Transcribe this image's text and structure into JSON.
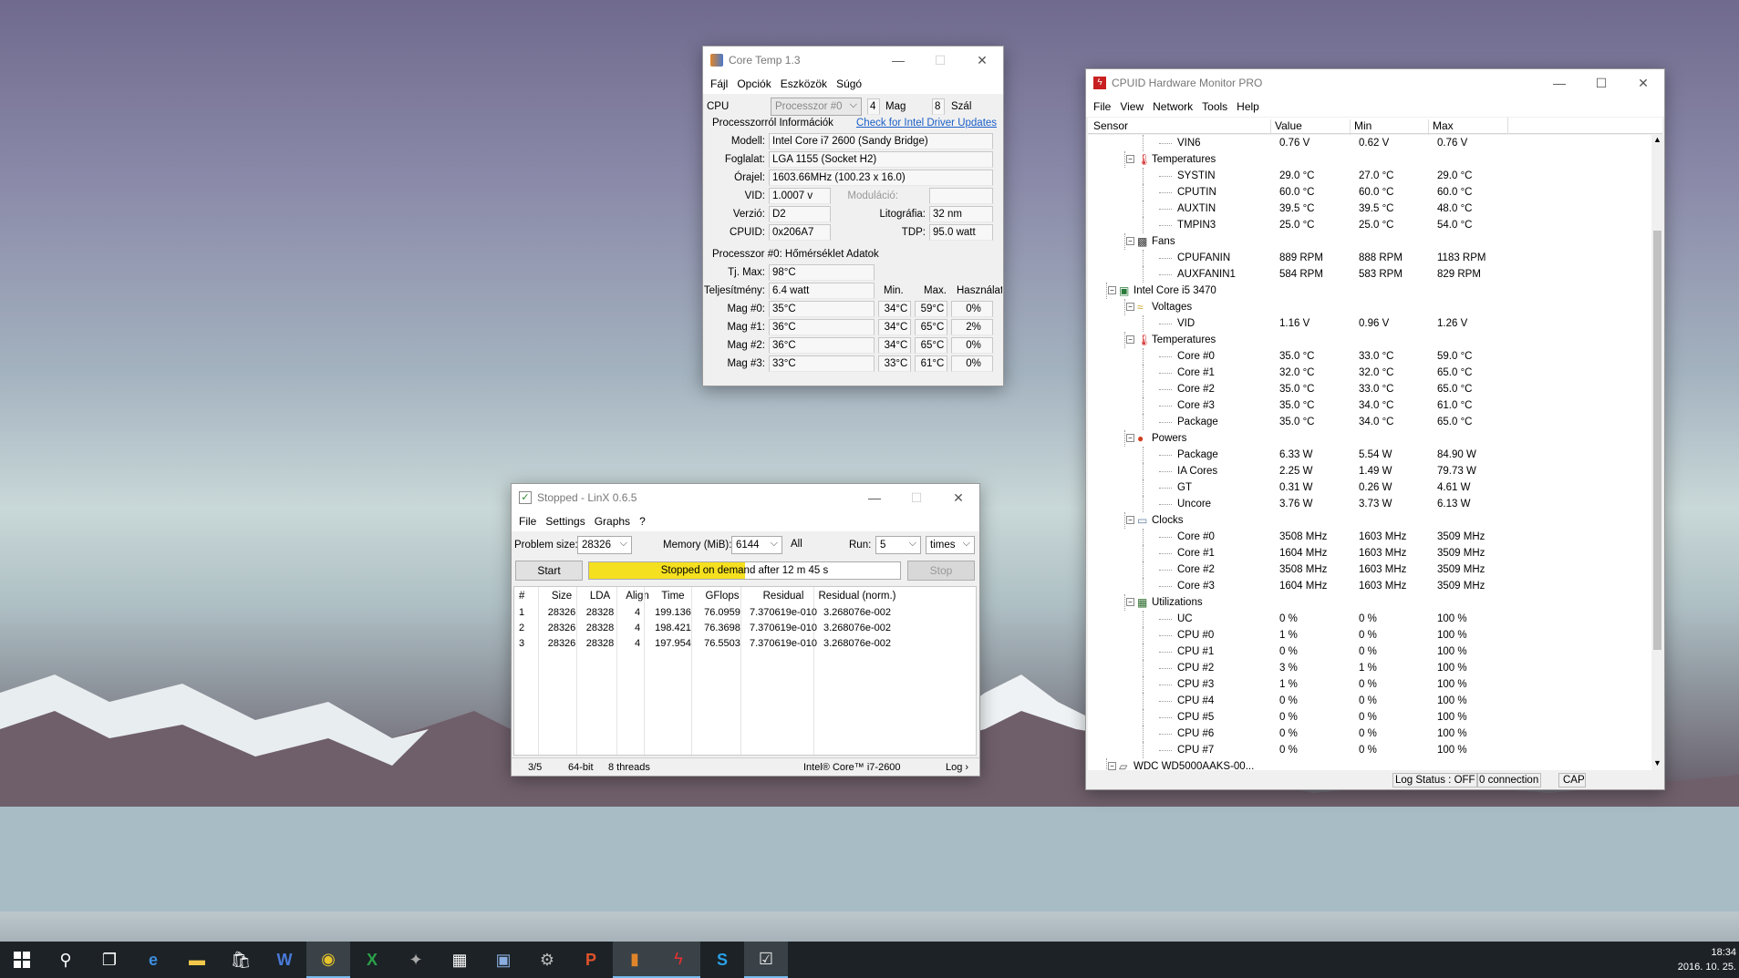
{
  "coretemp": {
    "title": "Core Temp 1.3",
    "menu": [
      "Fájl",
      "Opciók",
      "Eszközök",
      "Súgó"
    ],
    "cpu_label": "CPU",
    "processor_select": "Processzor #0",
    "cores": "4",
    "cores_label": "Mag",
    "threads": "8",
    "threads_label": "Szál",
    "info_header": "Processzorról Információk",
    "driver_link": "Check for Intel Driver Updates",
    "model_label": "Modell:",
    "model": "Intel Core i7 2600 (Sandy Bridge)",
    "socket_label": "Foglalat:",
    "socket": "LGA 1155 (Socket H2)",
    "clock_label": "Órajel:",
    "clock": "1603.66MHz (100.23 x 16.0)",
    "vid_label": "VID:",
    "vid": "1.0007 v",
    "mod_label": "Moduláció:",
    "mod": "",
    "rev_label": "Verzió:",
    "rev": "D2",
    "litho_label": "Litográfia:",
    "litho": "32 nm",
    "cpuid_label": "CPUID:",
    "cpuid": "0x206A7",
    "tdp_label": "TDP:",
    "tdp": "95.0 watt",
    "temp_header": "Processzor #0: Hőmérséklet Adatok",
    "tjmax_label": "Tj. Max:",
    "tjmax": "98°C",
    "power_label": "Teljesítmény:",
    "power": "6.4 watt",
    "min_h": "Min.",
    "max_h": "Max.",
    "load_h": "Használat",
    "cores_list": [
      {
        "label": "Mag #0:",
        "temp": "35°C",
        "min": "34°C",
        "max": "59°C",
        "load": "0%"
      },
      {
        "label": "Mag #1:",
        "temp": "36°C",
        "min": "34°C",
        "max": "65°C",
        "load": "2%"
      },
      {
        "label": "Mag #2:",
        "temp": "36°C",
        "min": "34°C",
        "max": "65°C",
        "load": "0%"
      },
      {
        "label": "Mag #3:",
        "temp": "33°C",
        "min": "33°C",
        "max": "61°C",
        "load": "0%"
      }
    ]
  },
  "linx": {
    "title": "Stopped - LinX 0.6.5",
    "menu": [
      "File",
      "Settings",
      "Graphs",
      "?"
    ],
    "problem_label": "Problem size:",
    "problem": "28326",
    "memory_label": "Memory (MiB):",
    "memory": "6144",
    "all": "All",
    "run_label": "Run:",
    "run": "5",
    "times": "times",
    "start": "Start",
    "status": "Stopped on demand after 12 m 45 s",
    "stop": "Stop",
    "headers": [
      "#",
      "Size",
      "LDA",
      "Align",
      "Time",
      "GFlops",
      "Residual",
      "Residual (norm.)"
    ],
    "rows": [
      [
        "1",
        "28326",
        "28328",
        "4",
        "199.136",
        "76.0959",
        "7.370619e-010",
        "3.268076e-002"
      ],
      [
        "2",
        "28326",
        "28328",
        "4",
        "198.421",
        "76.3698",
        "7.370619e-010",
        "3.268076e-002"
      ],
      [
        "3",
        "28326",
        "28328",
        "4",
        "197.954",
        "76.5503",
        "7.370619e-010",
        "3.268076e-002"
      ]
    ],
    "status_bar": [
      "3/5",
      "64-bit",
      "8 threads",
      "Intel® Core™ i7-2600",
      "Log ›"
    ]
  },
  "hwmon": {
    "title": "CPUID Hardware Monitor PRO",
    "menu": [
      "File",
      "View",
      "Network",
      "Tools",
      "Help"
    ],
    "headers": [
      "Sensor",
      "Value",
      "Min",
      "Max"
    ],
    "rows": [
      {
        "l": 3,
        "n": "VIN6",
        "v": "0.76 V",
        "mn": "0.62 V",
        "mx": "0.76 V"
      },
      {
        "l": 2,
        "n": "Temperatures",
        "v": "",
        "mn": "",
        "mx": "",
        "ic": "temp"
      },
      {
        "l": 3,
        "n": "SYSTIN",
        "v": "29.0 °C",
        "mn": "27.0 °C",
        "mx": "29.0 °C"
      },
      {
        "l": 3,
        "n": "CPUTIN",
        "v": "60.0 °C",
        "mn": "60.0 °C",
        "mx": "60.0 °C"
      },
      {
        "l": 3,
        "n": "AUXTIN",
        "v": "39.5 °C",
        "mn": "39.5 °C",
        "mx": "48.0 °C"
      },
      {
        "l": 3,
        "n": "TMPIN3",
        "v": "25.0 °C",
        "mn": "25.0 °C",
        "mx": "54.0 °C"
      },
      {
        "l": 2,
        "n": "Fans",
        "v": "",
        "mn": "",
        "mx": "",
        "ic": "fan"
      },
      {
        "l": 3,
        "n": "CPUFANIN",
        "v": "889 RPM",
        "mn": "888 RPM",
        "mx": "1183 RPM"
      },
      {
        "l": 3,
        "n": "AUXFANIN1",
        "v": "584 RPM",
        "mn": "583 RPM",
        "mx": "829 RPM"
      },
      {
        "l": 1,
        "n": "Intel Core i5 3470",
        "v": "",
        "mn": "",
        "mx": "",
        "ic": "chip"
      },
      {
        "l": 2,
        "n": "Voltages",
        "v": "",
        "mn": "",
        "mx": "",
        "ic": "volt"
      },
      {
        "l": 3,
        "n": "VID",
        "v": "1.16 V",
        "mn": "0.96 V",
        "mx": "1.26 V"
      },
      {
        "l": 2,
        "n": "Temperatures",
        "v": "",
        "mn": "",
        "mx": "",
        "ic": "temp"
      },
      {
        "l": 3,
        "n": "Core #0",
        "v": "35.0 °C",
        "mn": "33.0 °C",
        "mx": "59.0 °C"
      },
      {
        "l": 3,
        "n": "Core #1",
        "v": "32.0 °C",
        "mn": "32.0 °C",
        "mx": "65.0 °C"
      },
      {
        "l": 3,
        "n": "Core #2",
        "v": "35.0 °C",
        "mn": "33.0 °C",
        "mx": "65.0 °C"
      },
      {
        "l": 3,
        "n": "Core #3",
        "v": "35.0 °C",
        "mn": "34.0 °C",
        "mx": "61.0 °C"
      },
      {
        "l": 3,
        "n": "Package",
        "v": "35.0 °C",
        "mn": "34.0 °C",
        "mx": "65.0 °C"
      },
      {
        "l": 2,
        "n": "Powers",
        "v": "",
        "mn": "",
        "mx": "",
        "ic": "power"
      },
      {
        "l": 3,
        "n": "Package",
        "v": "6.33 W",
        "mn": "5.54 W",
        "mx": "84.90 W"
      },
      {
        "l": 3,
        "n": "IA Cores",
        "v": "2.25 W",
        "mn": "1.49 W",
        "mx": "79.73 W"
      },
      {
        "l": 3,
        "n": "GT",
        "v": "0.31 W",
        "mn": "0.26 W",
        "mx": "4.61 W"
      },
      {
        "l": 3,
        "n": "Uncore",
        "v": "3.76 W",
        "mn": "3.73 W",
        "mx": "6.13 W"
      },
      {
        "l": 2,
        "n": "Clocks",
        "v": "",
        "mn": "",
        "mx": "",
        "ic": "clock"
      },
      {
        "l": 3,
        "n": "Core #0",
        "v": "3508 MHz",
        "mn": "1603 MHz",
        "mx": "3509 MHz"
      },
      {
        "l": 3,
        "n": "Core #1",
        "v": "1604 MHz",
        "mn": "1603 MHz",
        "mx": "3509 MHz"
      },
      {
        "l": 3,
        "n": "Core #2",
        "v": "3508 MHz",
        "mn": "1603 MHz",
        "mx": "3509 MHz"
      },
      {
        "l": 3,
        "n": "Core #3",
        "v": "1604 MHz",
        "mn": "1603 MHz",
        "mx": "3509 MHz"
      },
      {
        "l": 2,
        "n": "Utilizations",
        "v": "",
        "mn": "",
        "mx": "",
        "ic": "util"
      },
      {
        "l": 3,
        "n": "UC",
        "v": "0 %",
        "mn": "0 %",
        "mx": "100 %"
      },
      {
        "l": 3,
        "n": "CPU #0",
        "v": "1 %",
        "mn": "0 %",
        "mx": "100 %"
      },
      {
        "l": 3,
        "n": "CPU #1",
        "v": "0 %",
        "mn": "0 %",
        "mx": "100 %"
      },
      {
        "l": 3,
        "n": "CPU #2",
        "v": "3 %",
        "mn": "1 %",
        "mx": "100 %"
      },
      {
        "l": 3,
        "n": "CPU #3",
        "v": "1 %",
        "mn": "0 %",
        "mx": "100 %"
      },
      {
        "l": 3,
        "n": "CPU #4",
        "v": "0 %",
        "mn": "0 %",
        "mx": "100 %"
      },
      {
        "l": 3,
        "n": "CPU #5",
        "v": "0 %",
        "mn": "0 %",
        "mx": "100 %"
      },
      {
        "l": 3,
        "n": "CPU #6",
        "v": "0 %",
        "mn": "0 %",
        "mx": "100 %"
      },
      {
        "l": 3,
        "n": "CPU #7",
        "v": "0 %",
        "mn": "0 %",
        "mx": "100 %"
      },
      {
        "l": 1,
        "n": "WDC WD5000AAKS-00...",
        "v": "",
        "mn": "",
        "mx": "",
        "ic": "disk"
      }
    ],
    "status": [
      "Log Status : OFF",
      "0 connection",
      "CAP"
    ]
  },
  "taskbar": {
    "time": "18:34",
    "date": "2016. 10. 25."
  }
}
